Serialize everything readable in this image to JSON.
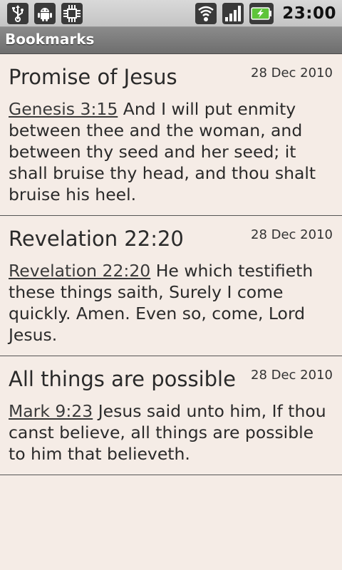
{
  "status_bar": {
    "icons_left": [
      "usb-icon",
      "android-icon",
      "chip-icon"
    ],
    "icons_right": [
      "wifi-icon",
      "signal-icon",
      "battery-charging-icon"
    ],
    "time": "23:00"
  },
  "title_bar": {
    "title": "Bookmarks"
  },
  "bookmarks": [
    {
      "title": "Promise of Jesus",
      "date": "28 Dec 2010",
      "reference": "Genesis 3:15",
      "text": "And I will put enmity between thee and the woman, and between thy seed and her seed; it shall bruise thy head, and thou shalt bruise his heel."
    },
    {
      "title": "Revelation 22:20",
      "date": "28 Dec 2010",
      "reference": "Revelation 22:20",
      "text": "He which testifieth these things saith, Surely I come quickly. Amen. Even so, come, Lord Jesus."
    },
    {
      "title": "All things are possible",
      "date": "28 Dec 2010",
      "reference": "Mark 9:23",
      "text": "Jesus said unto him, If thou canst believe, all things are possible to him that believeth."
    }
  ]
}
